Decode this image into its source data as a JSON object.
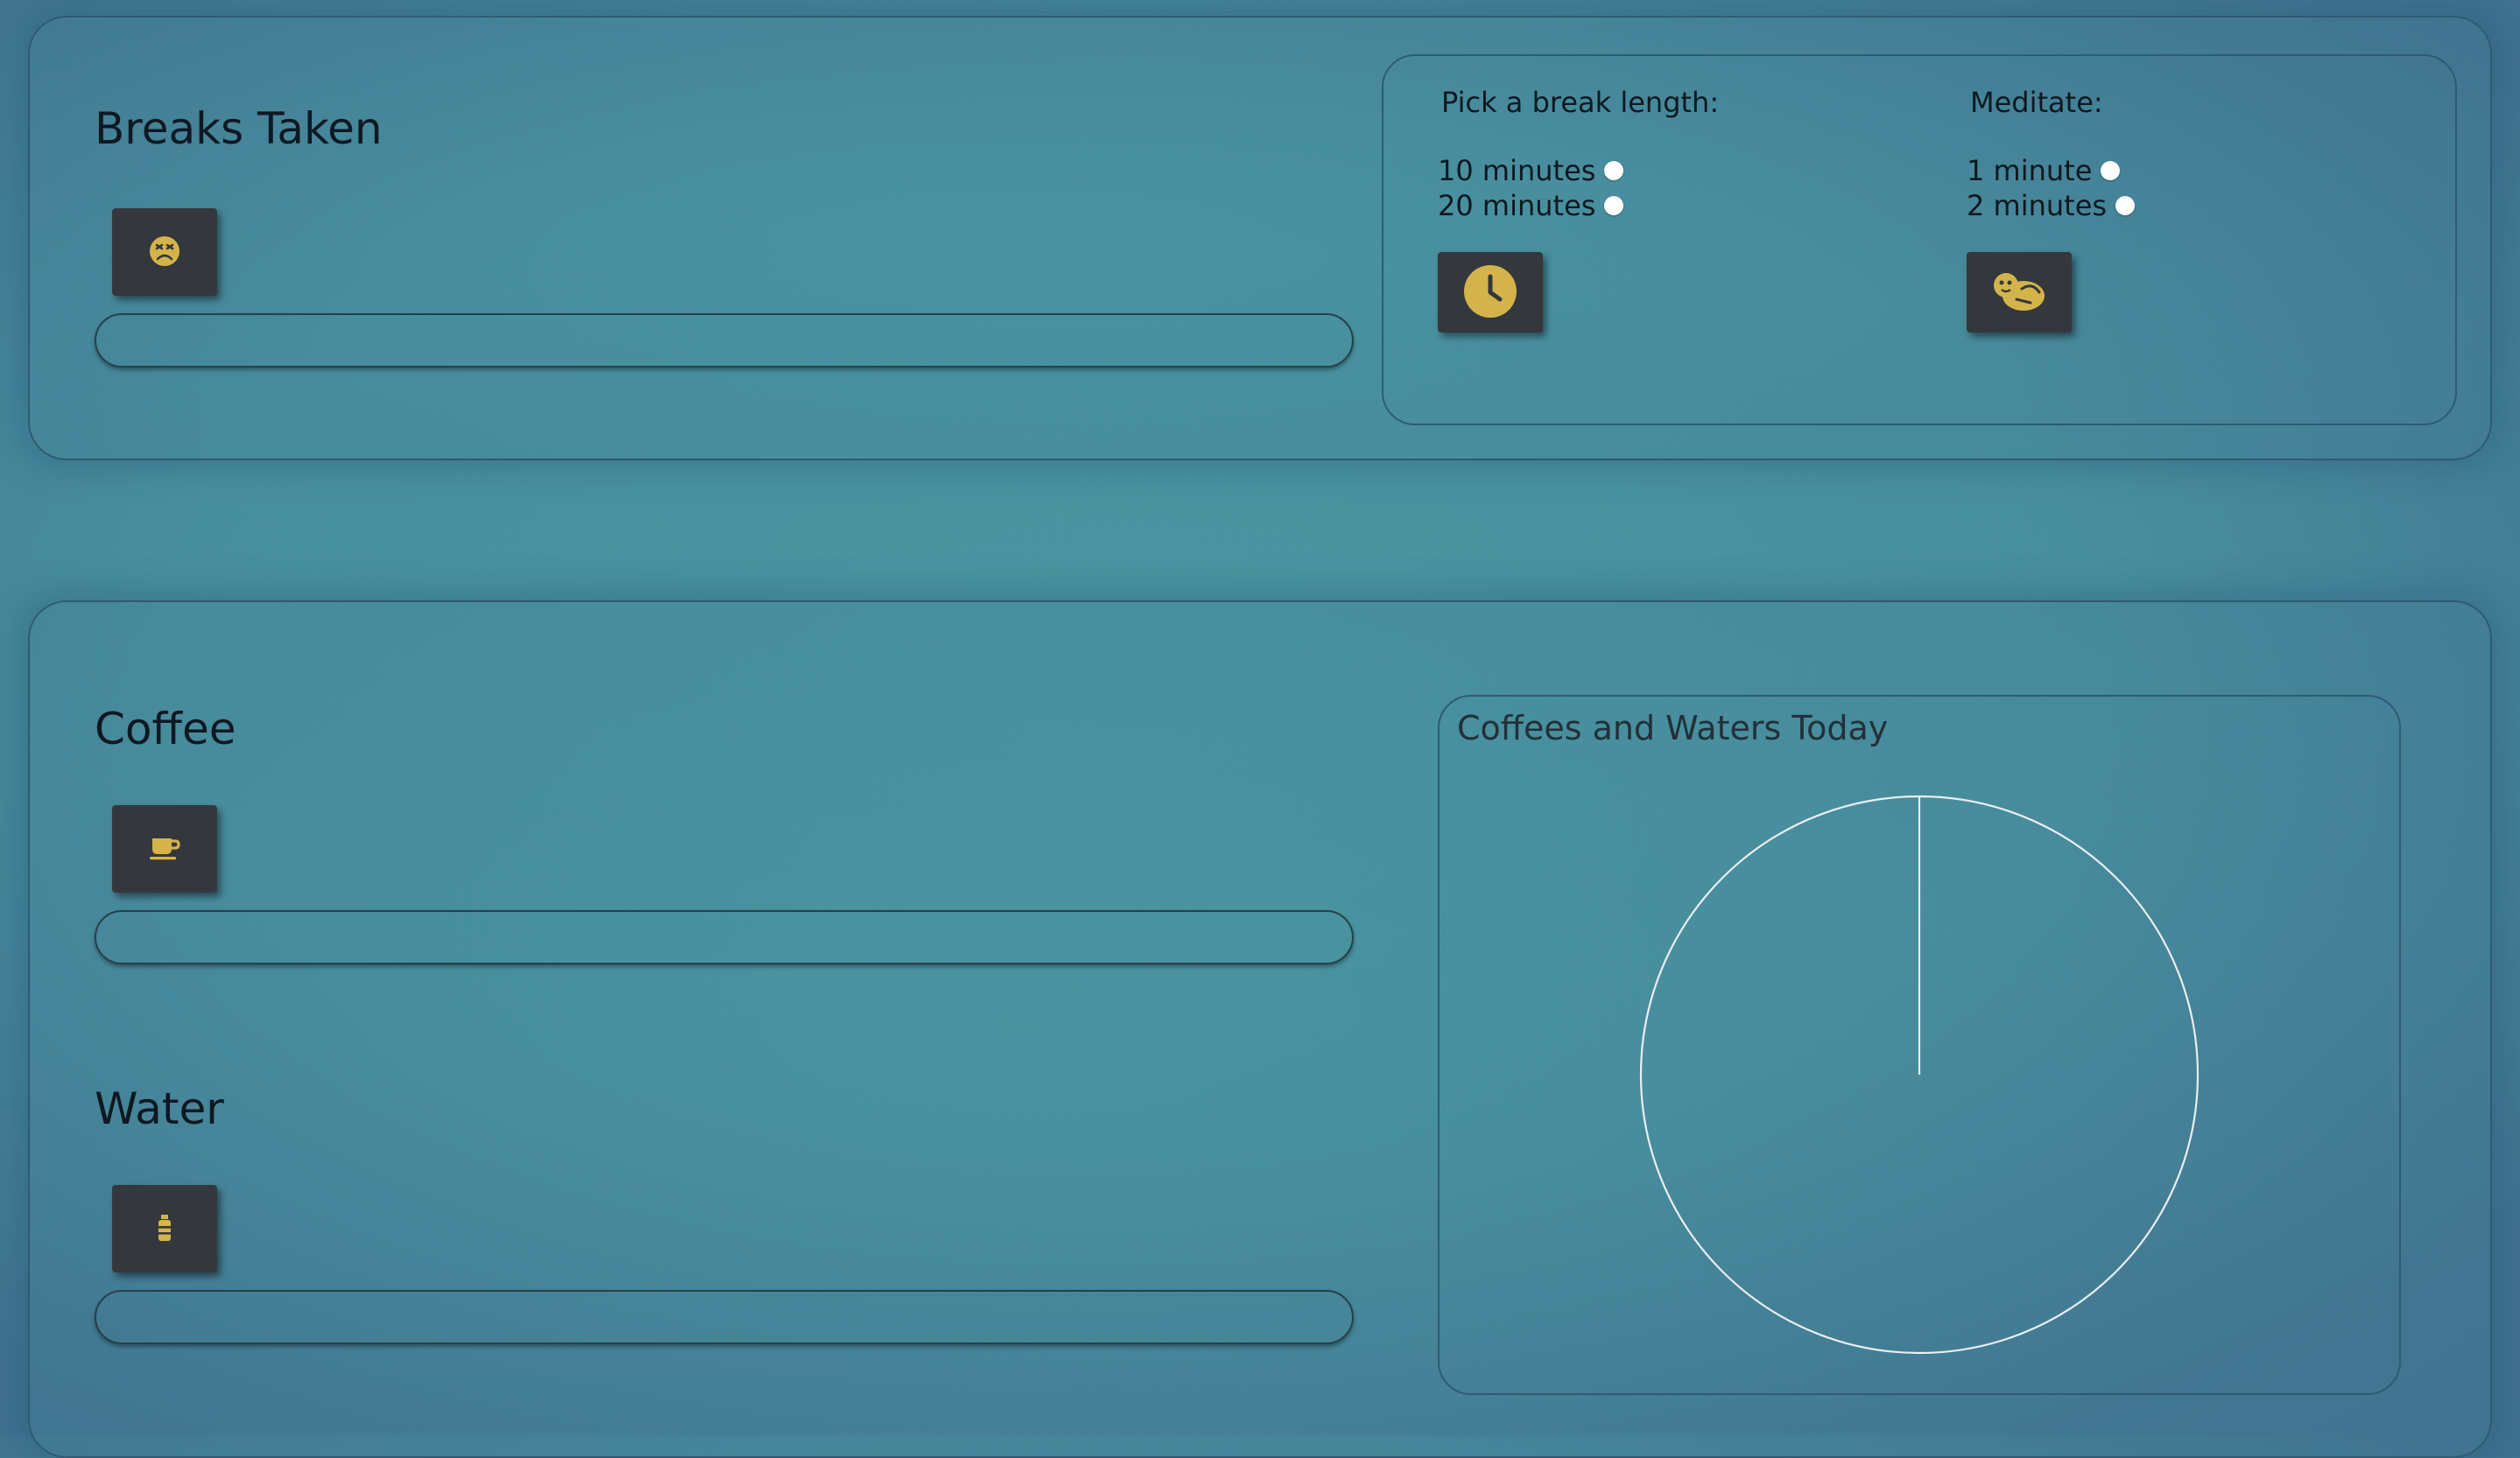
{
  "breaks": {
    "title": "Breaks Taken",
    "button_icon": "dizzy-face-icon",
    "progress": 0
  },
  "break_options": {
    "length_title": "Pick a break length:",
    "length_options": [
      "10 minutes",
      "20 minutes"
    ],
    "length_button_icon": "clock-icon",
    "meditate_title": "Meditate:",
    "meditate_options": [
      "1 minute",
      "2 minutes"
    ],
    "meditate_button_icon": "otter-icon"
  },
  "coffee": {
    "title": "Coffee",
    "button_icon": "coffee-cup-icon",
    "progress": 0
  },
  "water": {
    "title": "Water",
    "button_icon": "water-bottle-icon",
    "progress": 0
  },
  "chart_data": {
    "type": "pie",
    "title": "Coffees and Waters Today",
    "categories": [],
    "values": [],
    "colors": {
      "outline": "#e8eef0"
    }
  },
  "colors": {
    "button_bg": "#34383c",
    "icon_gold": "#d4b44a",
    "background": "#4a96a2"
  }
}
